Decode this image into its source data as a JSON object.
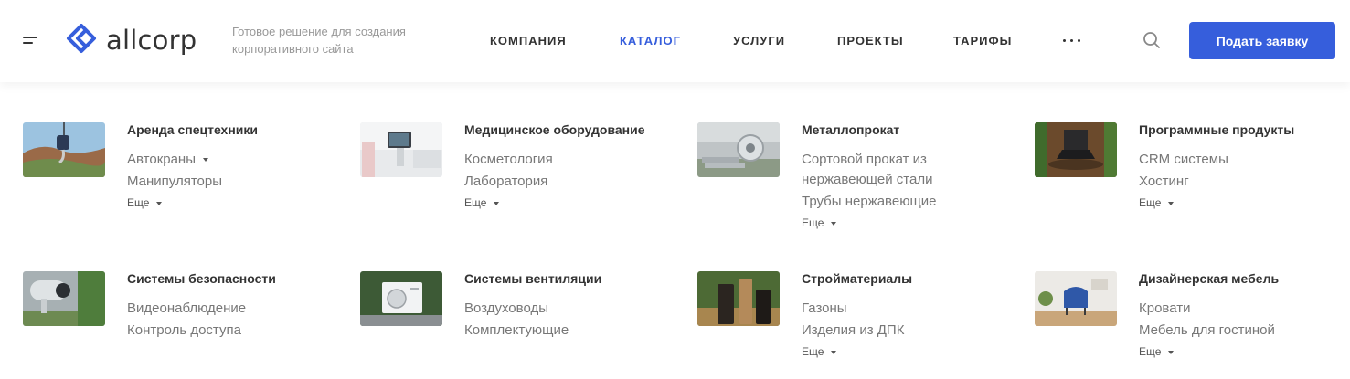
{
  "header": {
    "logo_text": "allcorp",
    "slogan_line1": "Готовое решение для создания",
    "slogan_line2": "корпоративного сайта",
    "nav": [
      {
        "label": "КОМПАНИЯ",
        "active": false
      },
      {
        "label": "КАТАЛОГ",
        "active": true
      },
      {
        "label": "УСЛУГИ",
        "active": false
      },
      {
        "label": "ПРОЕКТЫ",
        "active": false
      },
      {
        "label": "ТАРИФЫ",
        "active": false
      }
    ],
    "cta_label": "Подать заявку",
    "accent_color": "#365edc"
  },
  "catalog": {
    "row1": [
      {
        "title": "Аренда спецтехники",
        "links": [
          "Автокраны",
          "Манипуляторы"
        ],
        "more": "Еще"
      },
      {
        "title": "Медицинское оборудование",
        "links": [
          "Косметология",
          "Лаборатория"
        ],
        "more": "Еще"
      },
      {
        "title": "Металлопрокат",
        "links": [
          "Сортовой прокат из нержавеющей стали",
          "Трубы нержавеющие"
        ],
        "more": "Еще"
      },
      {
        "title": "Программные продукты",
        "links": [
          "CRM системы",
          "Хостинг"
        ],
        "more": "Еще"
      }
    ],
    "row2": [
      {
        "title": "Системы безопасности",
        "links": [
          "Видеонаблюдение",
          "Контроль доступа"
        ]
      },
      {
        "title": "Системы вентиляции",
        "links": [
          "Воздуховоды",
          "Комплектующие"
        ]
      },
      {
        "title": "Стройматериалы",
        "links": [
          "Газоны",
          "Изделия из ДПК"
        ],
        "more": "Еще"
      },
      {
        "title": "Дизайнерская мебель",
        "links": [
          "Кровати",
          "Мебель для гостиной"
        ],
        "more": "Еще"
      }
    ]
  }
}
